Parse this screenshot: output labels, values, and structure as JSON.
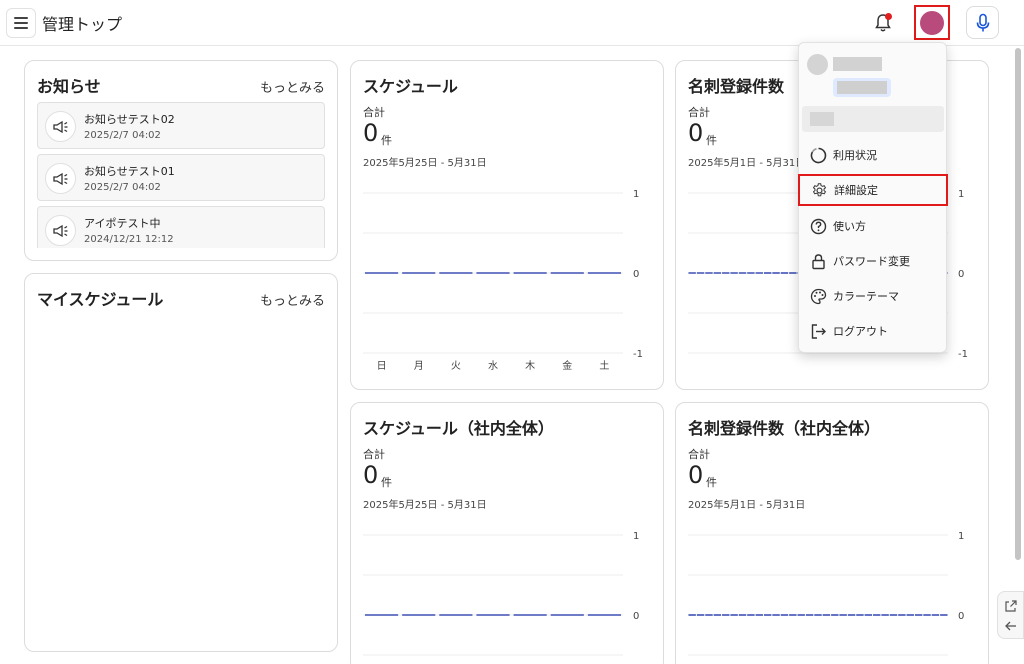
{
  "header": {
    "title": "管理トップ"
  },
  "notices": {
    "title": "お知らせ",
    "more": "もっとみる",
    "items": [
      {
        "title": "お知らせテスト02",
        "date": "2025/2/7 04:02"
      },
      {
        "title": "お知らせテスト01",
        "date": "2025/2/7 04:02"
      },
      {
        "title": "アイポテスト中",
        "date": "2024/12/21 12:12"
      }
    ]
  },
  "my_schedule": {
    "title": "マイスケジュール",
    "more": "もっとみる"
  },
  "cards": {
    "schedule": {
      "title": "スケジュール",
      "total_label": "合計",
      "value": "0",
      "unit": "件",
      "range": "2025年5月25日 - 5月31日"
    },
    "cards_registered": {
      "title": "名刺登録件数",
      "total_label": "合計",
      "value": "0",
      "unit": "件",
      "range": "2025年5月1日 - 5月31日"
    },
    "schedule_company": {
      "title": "スケジュール（社内全体）",
      "total_label": "合計",
      "value": "0",
      "unit": "件",
      "range": "2025年5月25日 - 5月31日"
    },
    "cards_company": {
      "title": "名刺登録件数（社内全体）",
      "total_label": "合計",
      "value": "0",
      "unit": "件",
      "range": "2025年5月1日 - 5月31日"
    }
  },
  "chart_data": [
    {
      "type": "line",
      "categories": [
        "日",
        "月",
        "火",
        "水",
        "木",
        "金",
        "土"
      ],
      "series": [
        {
          "values": [
            0,
            0,
            0,
            0,
            0,
            0,
            0
          ]
        }
      ],
      "yticks": [
        "1",
        "0",
        "-1"
      ],
      "ylim": [
        -1,
        1
      ],
      "color": "#3f51b5"
    },
    {
      "type": "line",
      "series": [
        {
          "values": [
            0,
            0,
            0,
            0,
            0,
            0,
            0,
            0,
            0,
            0,
            0,
            0,
            0,
            0,
            0,
            0,
            0,
            0,
            0,
            0,
            0,
            0,
            0,
            0,
            0,
            0,
            0,
            0,
            0,
            0,
            0
          ]
        }
      ],
      "yticks": [
        "1",
        "0",
        "-1"
      ],
      "ylim": [
        -1,
        1
      ],
      "color": "#3f51b5"
    },
    {
      "type": "line",
      "series": [
        {
          "values": [
            0,
            0,
            0,
            0,
            0,
            0,
            0
          ]
        }
      ],
      "yticks": [
        "1",
        "0"
      ],
      "ylim": [
        -1,
        1
      ],
      "color": "#3f51b5"
    },
    {
      "type": "line",
      "series": [
        {
          "values": [
            0,
            0,
            0,
            0,
            0,
            0,
            0,
            0,
            0,
            0,
            0,
            0,
            0,
            0,
            0,
            0,
            0,
            0,
            0,
            0,
            0,
            0,
            0,
            0,
            0,
            0,
            0,
            0,
            0,
            0,
            0
          ]
        }
      ],
      "yticks": [
        "1",
        "0"
      ],
      "ylim": [
        -1,
        1
      ],
      "color": "#3f51b5"
    }
  ],
  "user_menu": {
    "items": [
      {
        "label": "利用状況",
        "icon": "usage-icon"
      },
      {
        "label": "詳細設定",
        "icon": "gear-icon"
      },
      {
        "label": "使い方",
        "icon": "help-icon"
      },
      {
        "label": "パスワード変更",
        "icon": "lock-icon"
      },
      {
        "label": "カラーテーマ",
        "icon": "palette-icon"
      },
      {
        "label": "ログアウト",
        "icon": "logout-icon"
      }
    ]
  }
}
